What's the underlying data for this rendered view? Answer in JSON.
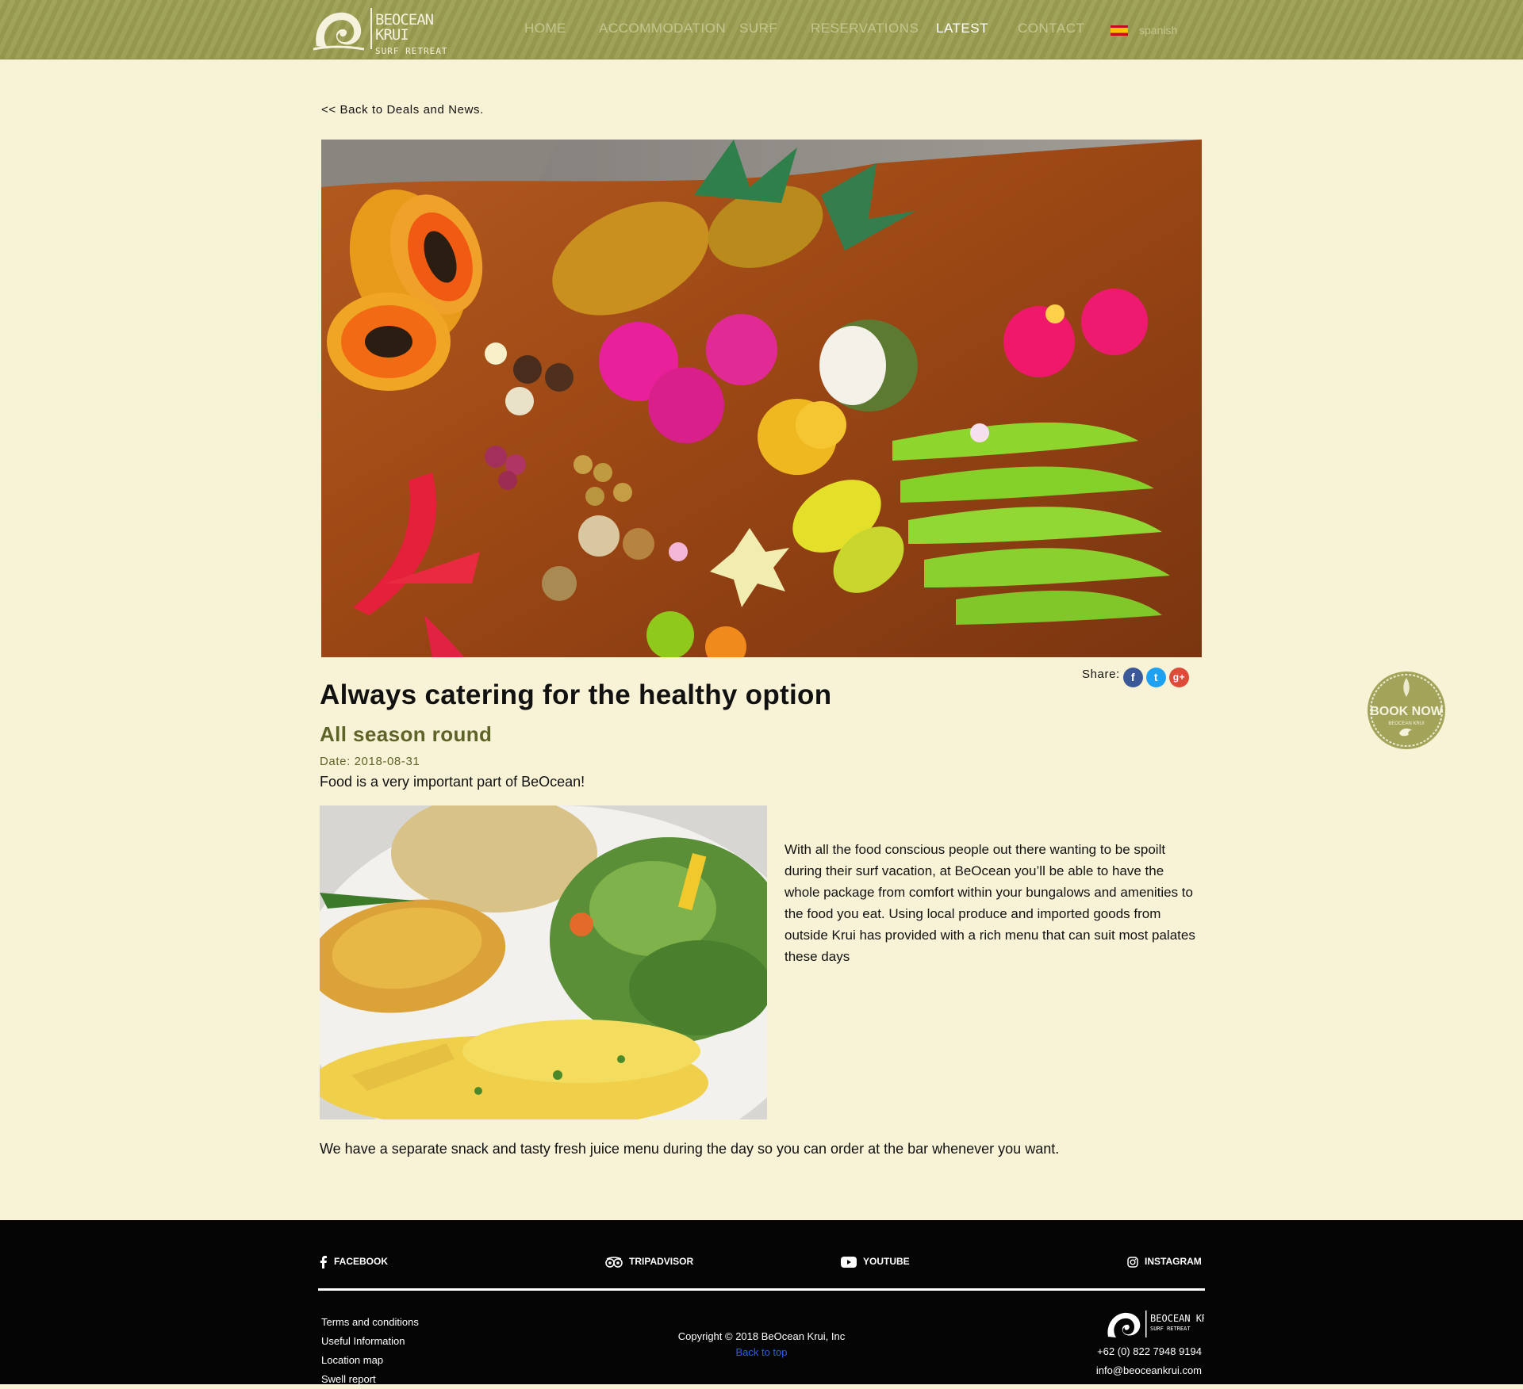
{
  "header": {
    "logo": {
      "name": "BEOCEAN KRUI",
      "tagline": "SURF RETREAT"
    },
    "nav": [
      {
        "label": "HOME",
        "active": false
      },
      {
        "label": "ACCOMMODATION",
        "active": false
      },
      {
        "label": "SURF",
        "active": false
      },
      {
        "label": "RESERVATIONS",
        "active": false
      },
      {
        "label": "LATEST",
        "active": true
      },
      {
        "label": "CONTACT",
        "active": false
      }
    ],
    "language": {
      "label": "spanish",
      "flag_icon": "spain-flag-icon"
    }
  },
  "article": {
    "back_link": "<< Back to Deals and News.",
    "share_label": "Share:",
    "share_icons": [
      "facebook-icon",
      "twitter-icon",
      "google-plus-icon"
    ],
    "title": "Always catering for the healthy option",
    "subtitle": "All season round",
    "date": "Date: 2018-08-31",
    "intro": "Food is a very important part of BeOcean!",
    "body": "With all the food conscious people out there wanting to be spoilt during their surf vacation, at BeOcean you’ll be able to have the whole package from comfort within your bungalows and amenities to the food you eat. Using local produce and imported goods from outside Krui has provided with a rich menu that can suit most palates these days",
    "closing": "We have a separate snack and tasty fresh juice menu during the day so you can order at the bar whenever you want."
  },
  "book_now": {
    "label": "BOOK NOW",
    "sub": "BEOCEAN KRUI"
  },
  "footer": {
    "social": [
      {
        "label": "FACEBOOK",
        "icon": "facebook-icon"
      },
      {
        "label": "TRIPADVISOR",
        "icon": "tripadvisor-icon"
      },
      {
        "label": "YOUTUBE",
        "icon": "youtube-icon"
      },
      {
        "label": "INSTAGRAM",
        "icon": "instagram-icon"
      }
    ],
    "links": [
      "Terms and conditions",
      "Useful Information",
      "Location map",
      "Swell report"
    ],
    "copyright": "Copyright © 2018 BeOcean Krui, Inc",
    "back_to_top": "Back to top",
    "logo": {
      "name": "BEOCEAN KRUI",
      "tagline": "SURF RETREAT"
    },
    "phone": "+62 (0) 822 7948 9194",
    "email": "info@beoceankrui.com"
  },
  "colors": {
    "header_bg": "#9c9f52",
    "page_bg": "#f8f3d6",
    "subtitle_olive": "#5e6428",
    "footer_bg": "#050505",
    "link_blue": "#2b5cff"
  }
}
